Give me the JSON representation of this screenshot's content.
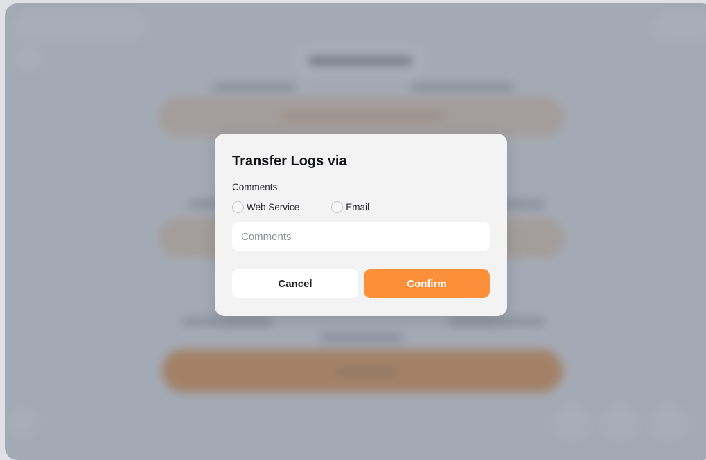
{
  "modal": {
    "title": "Transfer Logs via",
    "section_label": "Comments",
    "options": [
      {
        "label": "Web Service",
        "selected": false
      },
      {
        "label": "Email",
        "selected": false
      }
    ],
    "comments": {
      "placeholder": "Comments",
      "value": ""
    },
    "cancel_label": "Cancel",
    "confirm_label": "Confirm"
  },
  "colors": {
    "accent": "#fb8f3a",
    "overlay": "#737d8c",
    "modal_bg": "#f3f3f3"
  },
  "background": {
    "icons": [
      "back-icon",
      "user-icon",
      "home-icon",
      "settings-icon",
      "info-icon",
      "help-icon"
    ]
  }
}
